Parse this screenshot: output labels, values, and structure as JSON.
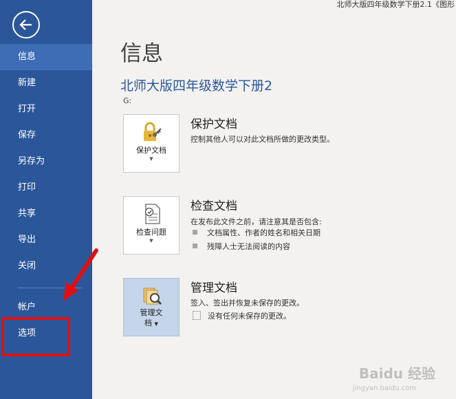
{
  "window": {
    "title": "北师大版四年级数学下册2.1《图形"
  },
  "sidebar": {
    "items": [
      {
        "label": "信息"
      },
      {
        "label": "新建"
      },
      {
        "label": "打开"
      },
      {
        "label": "保存"
      },
      {
        "label": "另存为"
      },
      {
        "label": "打印"
      },
      {
        "label": "共享"
      },
      {
        "label": "导出"
      },
      {
        "label": "关闭"
      },
      {
        "label": "帐户"
      },
      {
        "label": "选项"
      }
    ],
    "active_index": 0,
    "highlighted_item": "选项"
  },
  "main": {
    "title": "信息",
    "doc_title": "北师大版四年级数学下册2",
    "doc_path": "G:",
    "sections": [
      {
        "button_label": "保护文档",
        "heading": "保护文档",
        "description": "控制其他人可以对此文档所做的更改类型。",
        "icon": "lock-key-icon"
      },
      {
        "button_label": "检查问题",
        "heading": "检查文档",
        "description": "在发布此文件之前，请注意其是否包含:",
        "bullets": [
          "文档属性、作者的姓名和相关日期",
          "残障人士无法阅读的内容"
        ],
        "icon": "inspect-document-icon"
      },
      {
        "button_label_line1": "管理文",
        "button_label_line2": "档",
        "heading": "管理文档",
        "description": "签入、签出并恢复未保存的更改。",
        "bullets": [
          "没有任何未保存的更改。"
        ],
        "icon": "manage-document-icon"
      }
    ]
  },
  "colors": {
    "sidebar": "#2b579a",
    "accent": "#2b579a",
    "annotation": "#e01010"
  },
  "watermark": {
    "text": "Baidu 经验",
    "sub": "jingyan.baidu.com"
  }
}
